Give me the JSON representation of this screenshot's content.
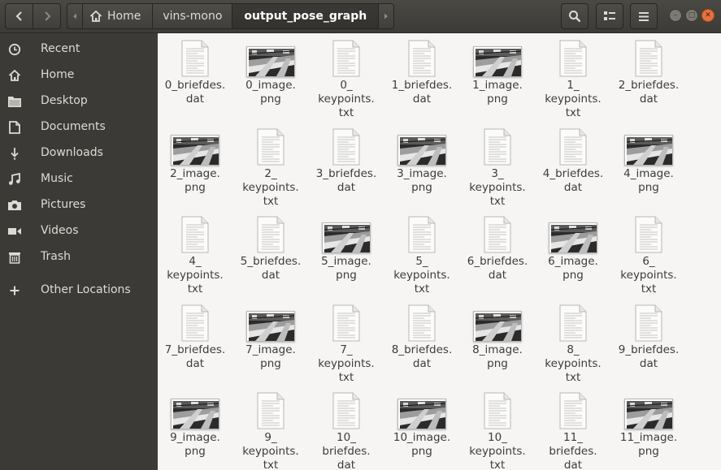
{
  "header": {
    "path": [
      "Home",
      "vins-mono",
      "output_pose_graph"
    ],
    "active_crumb": "output_pose_graph"
  },
  "sidebar": {
    "items": [
      {
        "label": "Recent",
        "icon": "clock-icon"
      },
      {
        "label": "Home",
        "icon": "home-icon"
      },
      {
        "label": "Desktop",
        "icon": "folder-icon"
      },
      {
        "label": "Documents",
        "icon": "document-icon"
      },
      {
        "label": "Downloads",
        "icon": "download-icon"
      },
      {
        "label": "Music",
        "icon": "music-icon"
      },
      {
        "label": "Pictures",
        "icon": "camera-icon"
      },
      {
        "label": "Videos",
        "icon": "video-icon"
      },
      {
        "label": "Trash",
        "icon": "trash-icon"
      },
      {
        "label": "Other Locations",
        "icon": "plus-icon"
      }
    ]
  },
  "files": [
    {
      "name": "0_briefdes.\ndat",
      "kind": "doc"
    },
    {
      "name": "0_image.\npng",
      "kind": "image"
    },
    {
      "name": "0_\nkeypoints.\ntxt",
      "kind": "doc"
    },
    {
      "name": "1_briefdes.\ndat",
      "kind": "doc"
    },
    {
      "name": "1_image.\npng",
      "kind": "image"
    },
    {
      "name": "1_\nkeypoints.\ntxt",
      "kind": "doc"
    },
    {
      "name": "2_briefdes.\ndat",
      "kind": "doc"
    },
    {
      "name": "2_image.\npng",
      "kind": "image"
    },
    {
      "name": "2_\nkeypoints.\ntxt",
      "kind": "doc"
    },
    {
      "name": "3_briefdes.\ndat",
      "kind": "doc"
    },
    {
      "name": "3_image.\npng",
      "kind": "image"
    },
    {
      "name": "3_\nkeypoints.\ntxt",
      "kind": "doc"
    },
    {
      "name": "4_briefdes.\ndat",
      "kind": "doc"
    },
    {
      "name": "4_image.\npng",
      "kind": "image"
    },
    {
      "name": "4_\nkeypoints.\ntxt",
      "kind": "doc"
    },
    {
      "name": "5_briefdes.\ndat",
      "kind": "doc"
    },
    {
      "name": "5_image.\npng",
      "kind": "image"
    },
    {
      "name": "5_\nkeypoints.\ntxt",
      "kind": "doc"
    },
    {
      "name": "6_briefdes.\ndat",
      "kind": "doc"
    },
    {
      "name": "6_image.\npng",
      "kind": "image"
    },
    {
      "name": "6_\nkeypoints.\ntxt",
      "kind": "doc"
    },
    {
      "name": "7_briefdes.\ndat",
      "kind": "doc"
    },
    {
      "name": "7_image.\npng",
      "kind": "image"
    },
    {
      "name": "7_\nkeypoints.\ntxt",
      "kind": "doc"
    },
    {
      "name": "8_briefdes.\ndat",
      "kind": "doc"
    },
    {
      "name": "8_image.\npng",
      "kind": "image"
    },
    {
      "name": "8_\nkeypoints.\ntxt",
      "kind": "doc"
    },
    {
      "name": "9_briefdes.\ndat",
      "kind": "doc"
    },
    {
      "name": "9_image.\npng",
      "kind": "image"
    },
    {
      "name": "9_\nkeypoints.\ntxt",
      "kind": "doc"
    },
    {
      "name": "10_\nbriefdes.\ndat",
      "kind": "doc"
    },
    {
      "name": "10_image.\npng",
      "kind": "image"
    },
    {
      "name": "10_\nkeypoints.\ntxt",
      "kind": "doc"
    },
    {
      "name": "11_\nbriefdes.\ndat",
      "kind": "doc"
    },
    {
      "name": "11_image.\npng",
      "kind": "image"
    }
  ],
  "colors": {
    "sidebar_bg": "#3b3a37",
    "header_bg": "#3c3b37",
    "content_bg": "#f6f5f4",
    "close_button": "#e9703f"
  }
}
